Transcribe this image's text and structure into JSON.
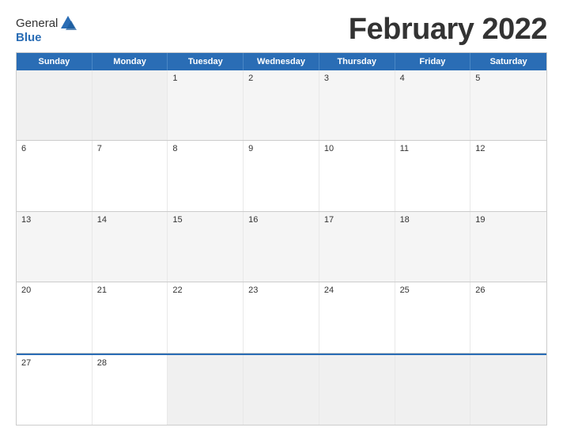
{
  "header": {
    "logo_general": "General",
    "logo_blue": "Blue",
    "month_title": "February 2022"
  },
  "calendar": {
    "days_of_week": [
      "Sunday",
      "Monday",
      "Tuesday",
      "Wednesday",
      "Thursday",
      "Friday",
      "Saturday"
    ],
    "weeks": [
      [
        "",
        "",
        "1",
        "2",
        "3",
        "4",
        "5"
      ],
      [
        "6",
        "7",
        "8",
        "9",
        "10",
        "11",
        "12"
      ],
      [
        "13",
        "14",
        "15",
        "16",
        "17",
        "18",
        "19"
      ],
      [
        "20",
        "21",
        "22",
        "23",
        "24",
        "25",
        "26"
      ],
      [
        "27",
        "28",
        "",
        "",
        "",
        "",
        ""
      ]
    ]
  }
}
